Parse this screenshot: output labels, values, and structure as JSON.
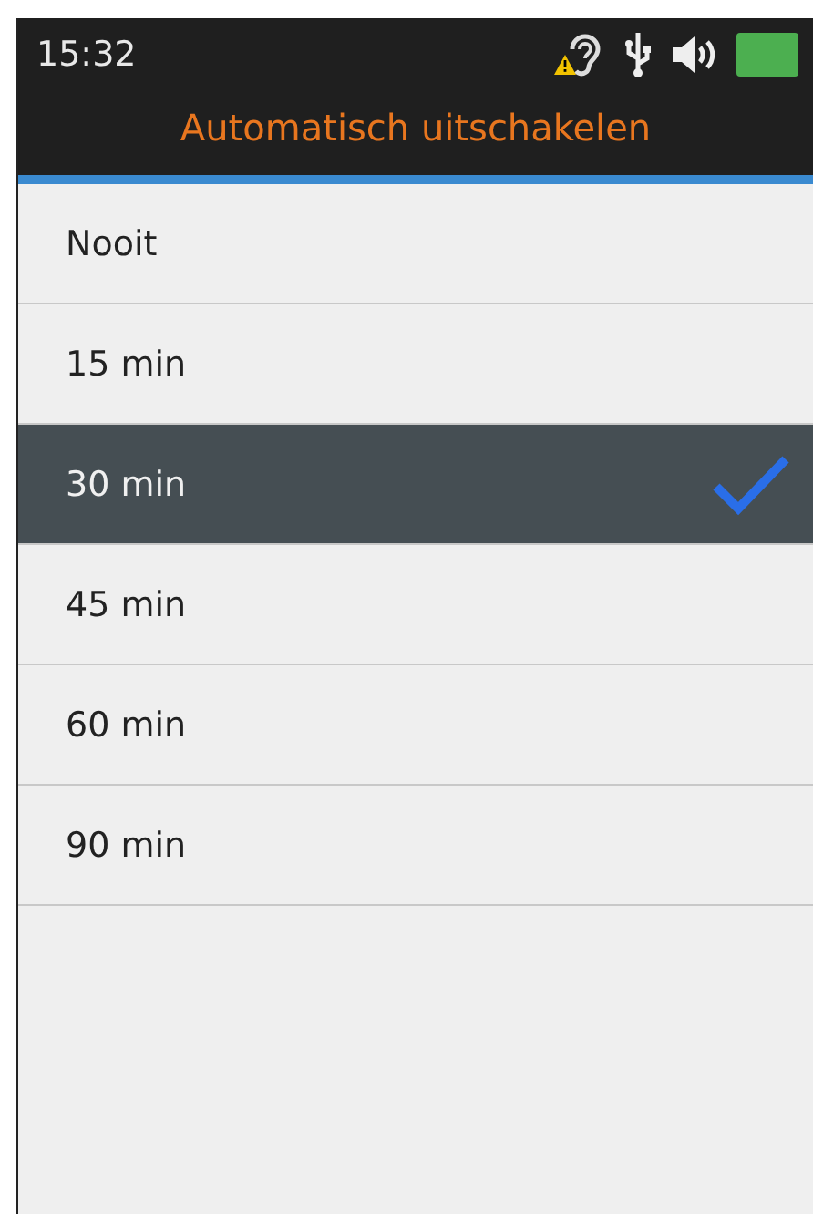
{
  "status_bar": {
    "time": "15:32",
    "hearing_warning": true
  },
  "title": "Automatisch uitschakelen",
  "options": [
    {
      "label": "Nooit",
      "selected": false
    },
    {
      "label": "15 min",
      "selected": false
    },
    {
      "label": "30 min",
      "selected": true
    },
    {
      "label": "45 min",
      "selected": false
    },
    {
      "label": "60 min",
      "selected": false
    },
    {
      "label": "90 min",
      "selected": false
    }
  ]
}
